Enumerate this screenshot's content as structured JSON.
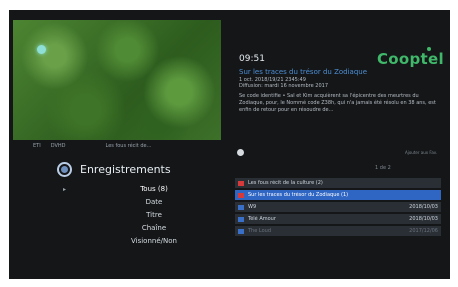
{
  "header": {
    "time": "09:51",
    "brand": "Cooptel"
  },
  "preview": {
    "caption_channel": "ETI",
    "caption_quality": "DVHD",
    "caption_title": "Les fous récit de..."
  },
  "program": {
    "title": "Sur les traces du trésor du Zodiaque",
    "meta_line1": "1 oct. 2018/19/21 2345:49",
    "meta_line2": "Diffusion: mardi 16 novembre 2017",
    "description": "Se code identifie • Sal et Kim acquièrent sa l'épicentre des meurtres du Zodiaque, pour, le Nommé code Z38h, qui n'a jamais été résolu en 38 ans, est enfin de retour pour en résoudre de..."
  },
  "info": {
    "label": "Ajouter aux Fav."
  },
  "menu": {
    "title": "Enregistrements",
    "caret": "▸",
    "items": [
      "Tous (8)",
      "Date",
      "Titre",
      "Chaîne",
      "Visionné/Non"
    ]
  },
  "list": {
    "page_indicator": "1 de 2",
    "rows": [
      {
        "name": "Les fous récit de la culture (2)",
        "date": "",
        "icon": "red-folder-icon"
      },
      {
        "name": "Sur les traces du trésor du Zodiaque (1)",
        "date": "",
        "icon": "red-folder-icon"
      },
      {
        "name": "W9",
        "date": "2018/10/03",
        "icon": "recording-icon"
      },
      {
        "name": "Télé Amour",
        "date": "2018/10/03",
        "icon": "recording-icon"
      },
      {
        "name": "The Loud",
        "date": "2017/12/06",
        "icon": "recording-icon"
      }
    ]
  },
  "colors": {
    "accent": "#2f66c4",
    "brand": "#3fb86a",
    "title": "#4d8fd6"
  }
}
